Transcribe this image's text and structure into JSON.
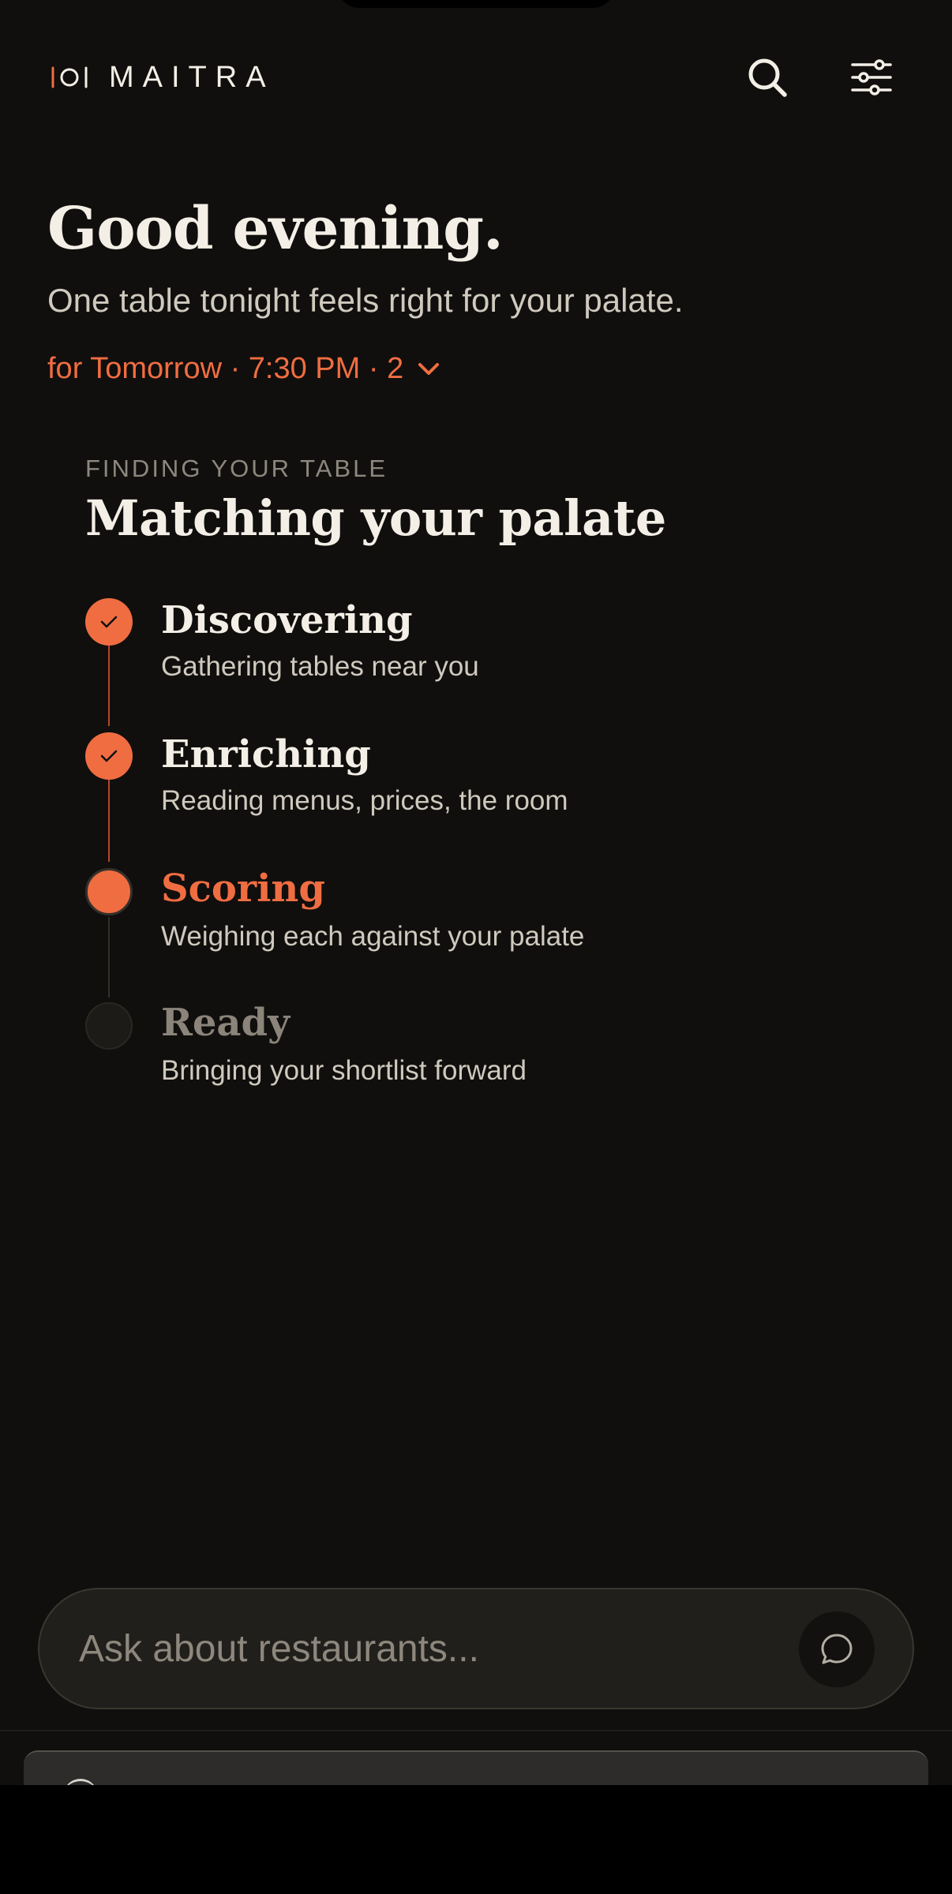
{
  "brand": {
    "name": "MAITRA",
    "icon": "plate-logo-icon"
  },
  "header": {
    "search_icon": "search-icon",
    "filter_icon": "sliders-icon"
  },
  "greeting": {
    "title": "Good evening.",
    "subtitle": "One table tonight feels right for your palate."
  },
  "reservation": {
    "summary": "for Tomorrow · 7:30 PM · 2",
    "icon": "chevron-down-icon"
  },
  "status": {
    "eyebrow": "FINDING YOUR TABLE",
    "title": "Matching your palate",
    "steps": [
      {
        "label": "Discovering",
        "description": "Gathering tables near you",
        "state": "done"
      },
      {
        "label": "Enriching",
        "description": "Reading menus, prices, the room",
        "state": "done"
      },
      {
        "label": "Scoring",
        "description": "Weighing each against your palate",
        "state": "active"
      },
      {
        "label": "Ready",
        "description": "Bringing your shortlist forward",
        "state": "pending"
      }
    ]
  },
  "ask": {
    "placeholder": "Ask about restaurants...",
    "icon": "chat-bubble-icon"
  },
  "colors": {
    "accent": "#f06d42",
    "background": "#100f0d",
    "text": "#f4efe6",
    "muted": "#8d877d"
  }
}
